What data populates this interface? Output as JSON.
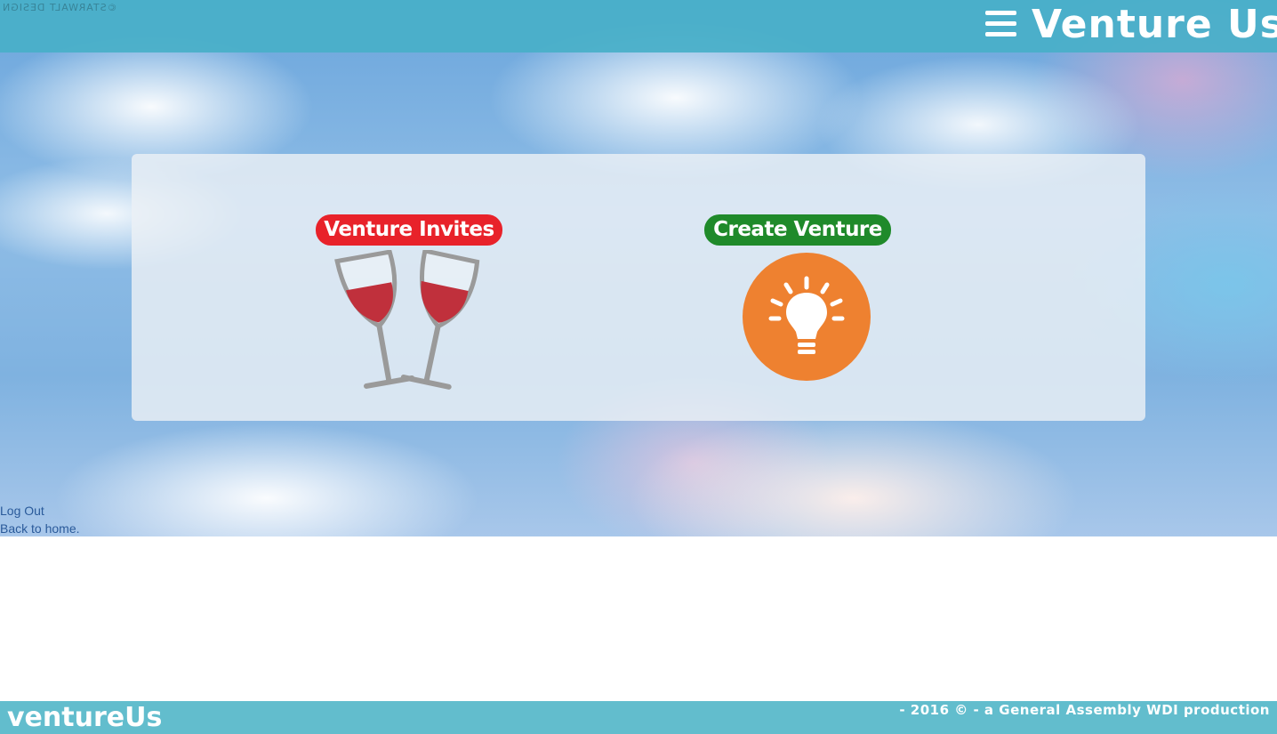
{
  "header": {
    "watermark": "©STARWALT DESIGN",
    "menu_icon": "hamburger-menu-icon",
    "title": "Venture Us"
  },
  "panel": {
    "invites_label": "Venture Invites",
    "invites_icon": "wine-glasses-icon",
    "create_label": "Create Venture",
    "create_icon": "lightbulb-icon"
  },
  "links": {
    "logout": "Log Out",
    "home": "Back to home."
  },
  "footer": {
    "brand": "ventureUs",
    "credit": "- 2016 © - a General Assembly WDI production"
  },
  "colors": {
    "topbar": "#48afc8",
    "footer": "#62bdcd",
    "invites_pill": "#e8222a",
    "create_pill": "#1f8a2a",
    "bulb_circle": "#ee8130",
    "wine": "#c0303c"
  }
}
